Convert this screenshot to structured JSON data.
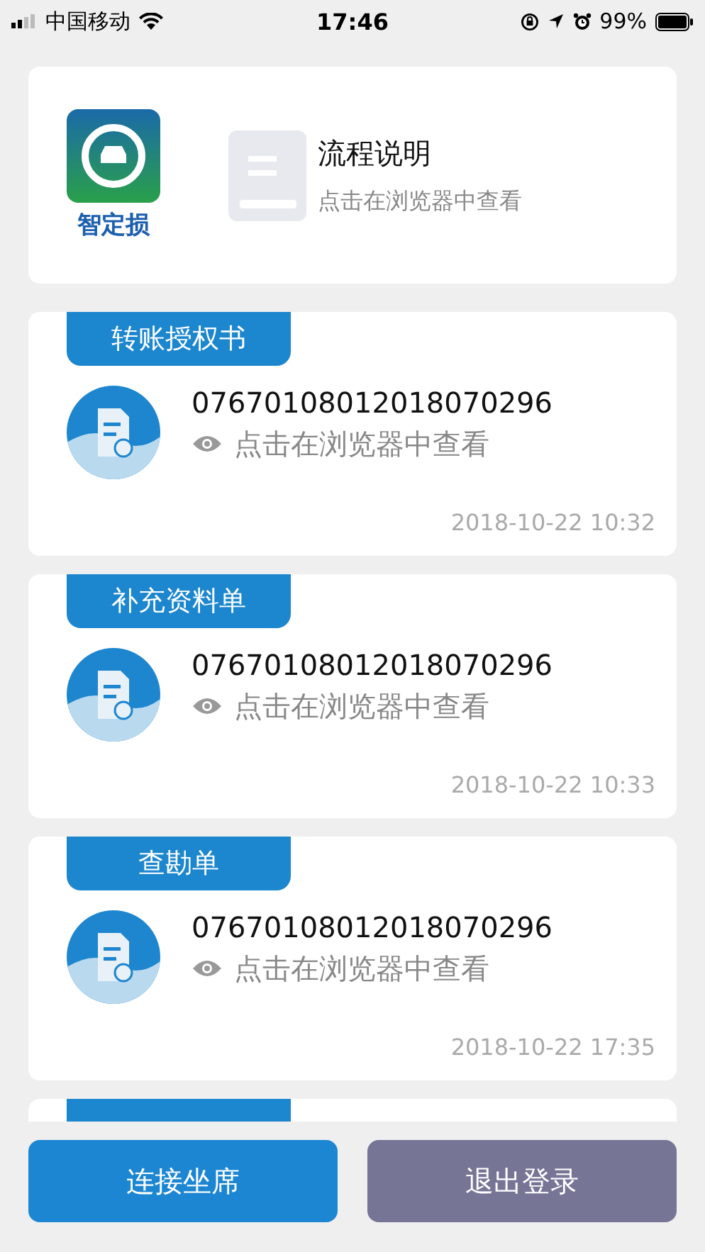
{
  "status_bar": {
    "carrier": "中国移动",
    "time": "17:46",
    "battery": "99%"
  },
  "header_card": {
    "logo_text": "智定损",
    "title": "流程说明",
    "subtitle": "点击在浏览器中查看"
  },
  "documents": [
    {
      "tag": "转账授权书",
      "number": "07670108012018070296",
      "link": "点击在浏览器中查看",
      "time": "2018-10-22 10:32"
    },
    {
      "tag": "补充资料单",
      "number": "07670108012018070296",
      "link": "点击在浏览器中查看",
      "time": "2018-10-22 10:33"
    },
    {
      "tag": "查勘单",
      "number": "07670108012018070296",
      "link": "点击在浏览器中查看",
      "time": "2018-10-22 17:35"
    },
    {
      "kind": "partial"
    }
  ],
  "buttons": [
    {
      "label": "连接坐席",
      "kind": "primary"
    },
    {
      "label": "退出登录",
      "kind": "secondary"
    }
  ]
}
